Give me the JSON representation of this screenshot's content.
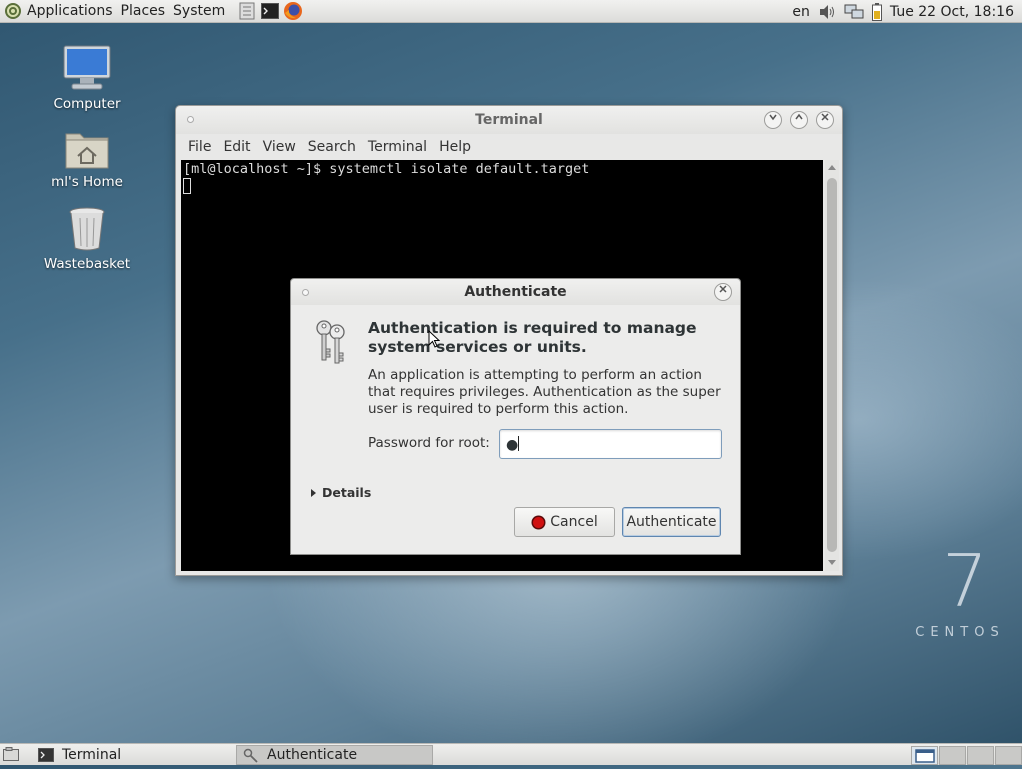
{
  "top_panel": {
    "menus": [
      "Applications",
      "Places",
      "System"
    ],
    "keyboard_layout": "en",
    "clock": "Tue 22 Oct, 18:16"
  },
  "desktop": {
    "icons": [
      {
        "label": "Computer",
        "icon": "computer-icon"
      },
      {
        "label": "ml's Home",
        "icon": "home-folder-icon"
      },
      {
        "label": "Wastebasket",
        "icon": "trash-icon"
      }
    ],
    "logo": {
      "number": "7",
      "text": "CENTOS"
    }
  },
  "terminal": {
    "title": "Terminal",
    "menu": [
      "File",
      "Edit",
      "View",
      "Search",
      "Terminal",
      "Help"
    ],
    "line1": "[ml@localhost ~]$ systemctl isolate default.target"
  },
  "auth_dialog": {
    "title": "Authenticate",
    "heading": "Authentication is required to manage system services or units.",
    "description": "An application is attempting to perform an action that requires privileges. Authentication as the super user is required to perform this action.",
    "password_label": "Password for root:",
    "password_value": "●",
    "details_label": "Details",
    "cancel_label": "Cancel",
    "authenticate_label": "Authenticate"
  },
  "taskbar": {
    "tasks": [
      "Terminal",
      "Authenticate"
    ]
  },
  "colors": {
    "accent": "#7f9dbb",
    "cancel_icon": "#d01010"
  }
}
